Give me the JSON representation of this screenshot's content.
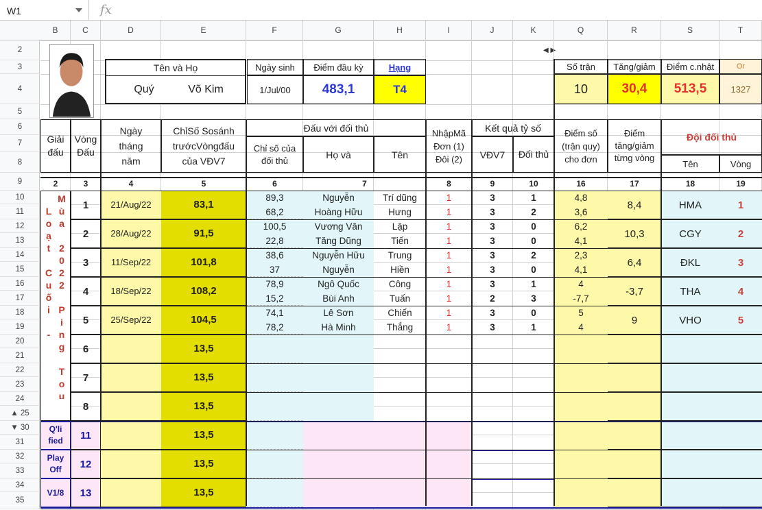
{
  "formula_bar": {
    "cell": "W1",
    "fx": "fx"
  },
  "columns": [
    "B",
    "C",
    "D",
    "E",
    "F",
    "G",
    "H",
    "I",
    "J",
    "K",
    "Q",
    "R",
    "S",
    "T"
  ],
  "rows": [
    "2",
    "3",
    "4",
    "5",
    "6",
    "7",
    "8",
    "9",
    "10",
    "11",
    "12",
    "13",
    "14",
    "15",
    "16",
    "17",
    "18",
    "19",
    "20",
    "21",
    "22",
    "23",
    "24",
    "25",
    "30",
    "31",
    "32",
    "33",
    "34",
    "35"
  ],
  "header": {
    "name_label": "Tên    và    Họ",
    "first": "Quý",
    "last": "Võ Kim",
    "dob_label": "Ngày sinh",
    "dob": "1/Jul/00",
    "start_label": "Điểm đầu kỳ",
    "start": "483,1",
    "rank_label": "Hạng",
    "rank": "T4",
    "matches_label": "Số trận",
    "matches": "10",
    "delta_label": "Tăng/giảm",
    "delta": "30,4",
    "current_label": "Điểm c.nhật",
    "current": "513,5",
    "or_label": "Or",
    "or": "1327"
  },
  "labels": {
    "giai": "Giải đấu",
    "vong": "Vòng Đấu",
    "ngay": "Ngày tháng năm",
    "chiso": "ChỉSố Sosánh trướcVòngđấu của VĐV7",
    "dau": "Đấu với đối thủ",
    "chiso_dt": "Chỉ số của đối thủ",
    "ho": "Họ    và",
    "ten": "Tên",
    "nhap": "NhậpMã Đơn (1) Đôi (2)",
    "kq": "Kết quả tỷ số",
    "vdv": "VĐV7",
    "doithu": "Đối thủ",
    "diemso": "Điểm số (trận quy) cho đơn",
    "diemtg": "Điểm tăng/giảm từng vòng",
    "doi": "Đội đối thủ",
    "doi_ten": "Tên",
    "doi_vong": "Vòng"
  },
  "col_numbers": [
    "2",
    "3",
    "4",
    "5",
    "6",
    "7",
    "8",
    "9",
    "10",
    "16",
    "17",
    "18",
    "19"
  ],
  "season_text": "Mùa 2022 Ping Tour",
  "loat_text": "Loạt Cuối -",
  "rounds": [
    {
      "vong": "1",
      "date": "21/Aug/22",
      "chiso": "83,1",
      "sub": [
        {
          "cs": "89,3",
          "ho": "Nguyễn",
          "ten": "Trí dũng",
          "code": "1",
          "a": "3",
          "b": "1",
          "ds": "4,8"
        },
        {
          "cs": "68,2",
          "ho": "Hoàng Hữu",
          "ten": "Hưng",
          "code": "1",
          "a": "3",
          "b": "2",
          "ds": "3,6"
        }
      ],
      "tg": "8,4",
      "team": "HMA",
      "tv": "1"
    },
    {
      "vong": "2",
      "date": "28/Aug/22",
      "chiso": "91,5",
      "sub": [
        {
          "cs": "100,5",
          "ho": "Vương Văn",
          "ten": "Lập",
          "code": "1",
          "a": "3",
          "b": "0",
          "ds": "6,2"
        },
        {
          "cs": "22,8",
          "ho": "Tăng Dũng",
          "ten": "Tiến",
          "code": "1",
          "a": "3",
          "b": "0",
          "ds": "4,1"
        }
      ],
      "tg": "10,3",
      "team": "CGY",
      "tv": "2"
    },
    {
      "vong": "3",
      "date": "11/Sep/22",
      "chiso": "101,8",
      "sub": [
        {
          "cs": "38,6",
          "ho": "Nguyễn Hữu",
          "ten": "Trung",
          "code": "1",
          "a": "3",
          "b": "2",
          "ds": "2,3"
        },
        {
          "cs": "37",
          "ho": "Nguyễn",
          "ten": "Hiền",
          "code": "1",
          "a": "3",
          "b": "0",
          "ds": "4,1"
        }
      ],
      "tg": "6,4",
      "team": "ĐKL",
      "tv": "3"
    },
    {
      "vong": "4",
      "date": "18/Sep/22",
      "chiso": "108,2",
      "sub": [
        {
          "cs": "78,9",
          "ho": "Ngô Quốc",
          "ten": "Công",
          "code": "1",
          "a": "3",
          "b": "1",
          "ds": "4"
        },
        {
          "cs": "15,2",
          "ho": "Bùi Anh",
          "ten": "Tuấn",
          "code": "1",
          "a": "2",
          "b": "3",
          "ds": "-7,7"
        }
      ],
      "tg": "-3,7",
      "team": "THA",
      "tv": "4"
    },
    {
      "vong": "5",
      "date": "25/Sep/22",
      "chiso": "104,5",
      "sub": [
        {
          "cs": "74,1",
          "ho": "Lê Sơn",
          "ten": "Chiến",
          "code": "1",
          "a": "3",
          "b": "0",
          "ds": "5"
        },
        {
          "cs": "78,2",
          "ho": "Hà Minh",
          "ten": "Thắng",
          "code": "1",
          "a": "3",
          "b": "1",
          "ds": "4"
        }
      ],
      "tg": "9",
      "team": "VHO",
      "tv": "5"
    },
    {
      "vong": "6",
      "chiso": "13,5"
    },
    {
      "vong": "7",
      "chiso": "13,5"
    },
    {
      "vong": "8",
      "chiso": "13,5"
    },
    {
      "vong": "11",
      "chiso": "13,5",
      "label": "Q'li fied"
    },
    {
      "vong": "12",
      "chiso": "13,5",
      "label": "Play Off"
    },
    {
      "vong": "13",
      "chiso": "13,5",
      "label": "V1/8"
    }
  ]
}
